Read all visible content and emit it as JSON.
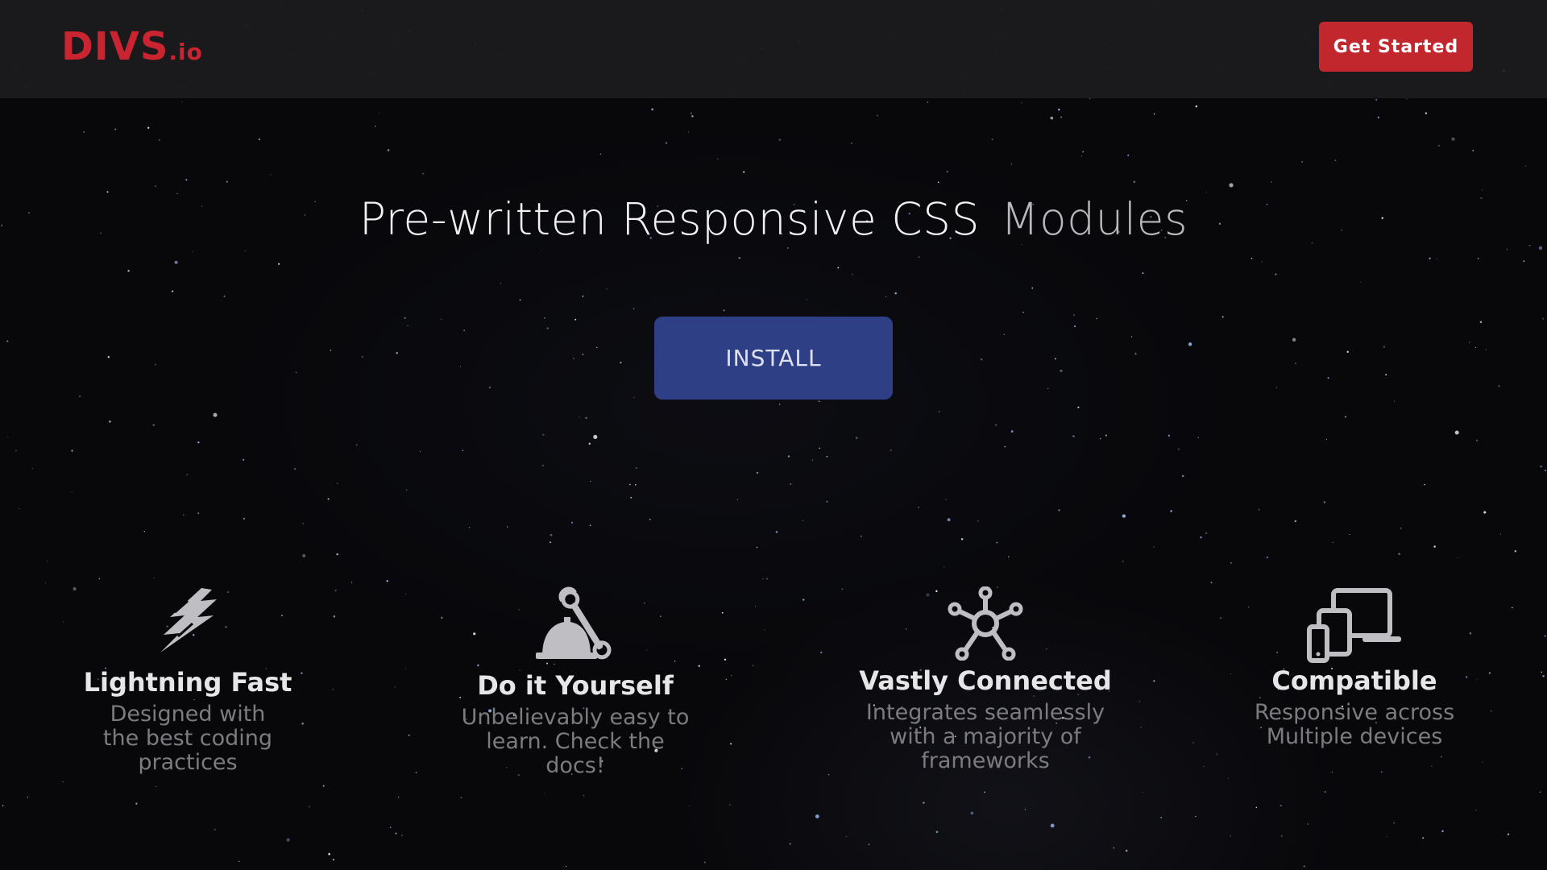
{
  "brand": {
    "name": "DIVS",
    "tld": ".io",
    "color": "#c9242f"
  },
  "header": {
    "cta_label": "Get Started",
    "cta_color": "#c1272d"
  },
  "hero": {
    "title_primary": "Pre-written Responsive CSS",
    "title_secondary": "Modules",
    "install_label": "INSTALL",
    "install_color": "#2e3f86"
  },
  "features": [
    {
      "icon": "lightning-icon",
      "title": "Lightning Fast",
      "description": "Designed with the best coding practices"
    },
    {
      "icon": "hardhat-wrench-icon",
      "title": "Do it Yourself",
      "description": "Unbelievably easy to learn. Check the docs!"
    },
    {
      "icon": "network-hub-icon",
      "title": "Vastly Connected",
      "description": "Integrates seamlessly with a majority of frameworks"
    },
    {
      "icon": "devices-icon",
      "title": "Compatible",
      "description": "Responsive across Multiple devices"
    }
  ],
  "background": {
    "theme": "starfield"
  }
}
